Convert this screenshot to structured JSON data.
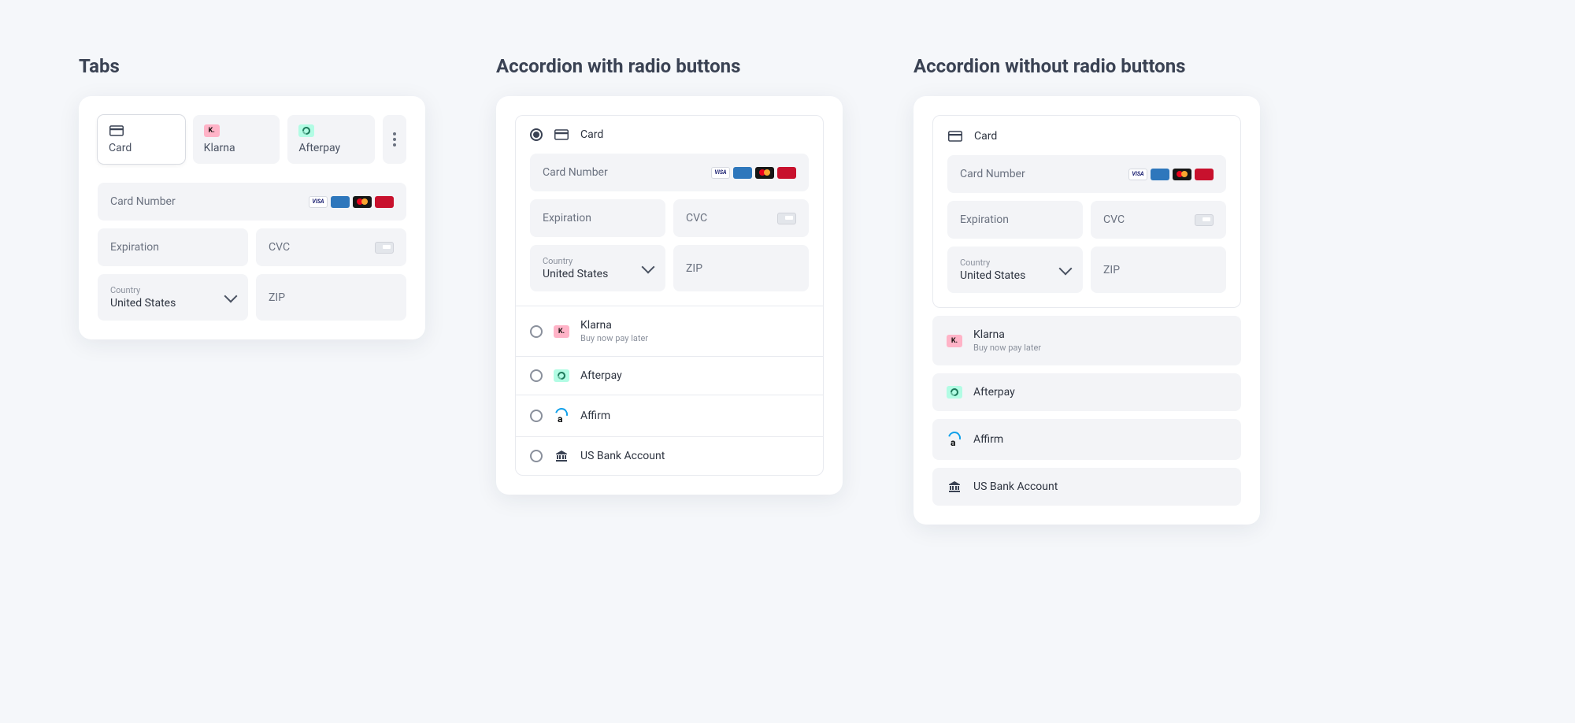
{
  "columns": {
    "tabs": {
      "title": "Tabs"
    },
    "radio": {
      "title": "Accordion with radio buttons"
    },
    "noradio": {
      "title": "Accordion without radio buttons"
    }
  },
  "methods": {
    "card": {
      "label": "Card"
    },
    "klarna": {
      "label": "Klarna",
      "sublabel": "Buy now pay later"
    },
    "afterpay": {
      "label": "Afterpay"
    },
    "affirm": {
      "label": "Affirm"
    },
    "bank": {
      "label": "US Bank Account"
    }
  },
  "fields": {
    "cardnumber": {
      "placeholder": "Card Number"
    },
    "expiration": {
      "placeholder": "Expiration"
    },
    "cvc": {
      "placeholder": "CVC"
    },
    "country": {
      "label": "Country",
      "value": "United States"
    },
    "zip": {
      "placeholder": "ZIP"
    }
  },
  "brands": {
    "visa": "VISA",
    "amex": "AMEX",
    "up": "Union Pay"
  }
}
